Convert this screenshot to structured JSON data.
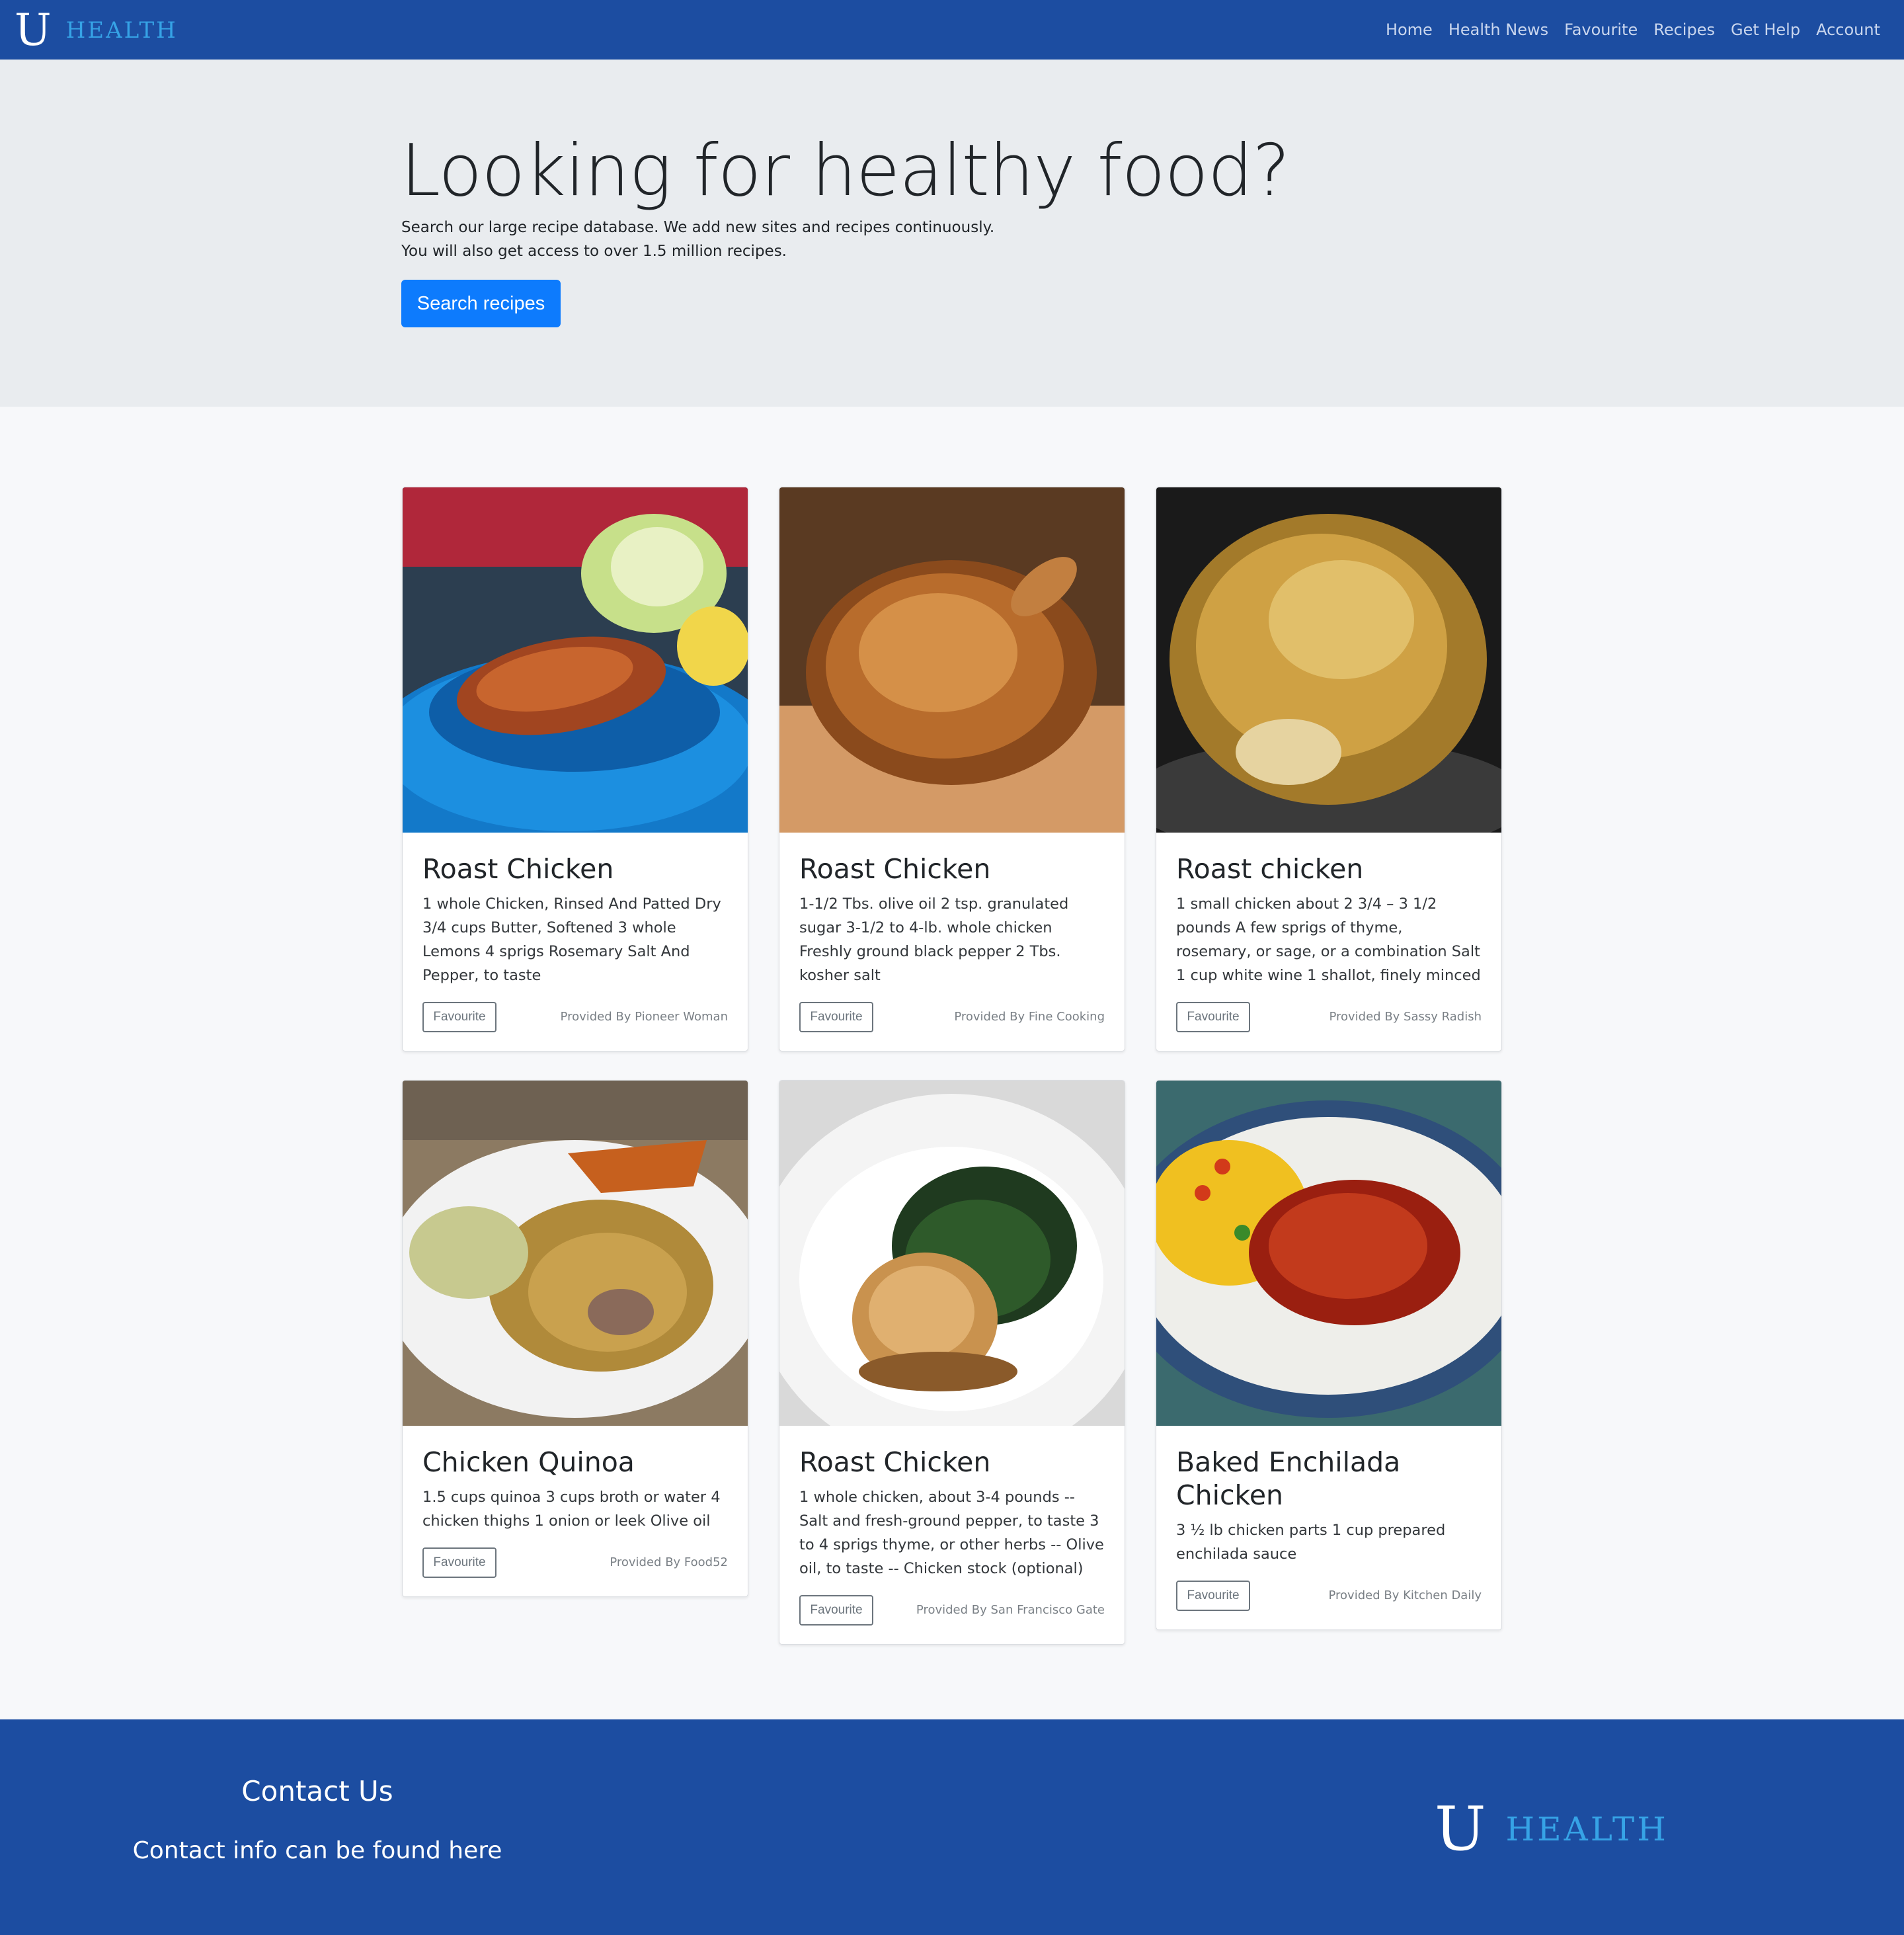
{
  "brand": {
    "letter": "U",
    "word": "HEALTH"
  },
  "nav": [
    {
      "label": "Home"
    },
    {
      "label": "Health News"
    },
    {
      "label": "Favourite"
    },
    {
      "label": "Recipes"
    },
    {
      "label": "Get Help"
    },
    {
      "label": "Account"
    }
  ],
  "hero": {
    "title": "Looking for healthy food?",
    "line1": "Search our large recipe database. We add new sites and recipes continuously.",
    "line2": "You will also get access to over 1.5 million recipes.",
    "button": "Search recipes"
  },
  "cards": [
    {
      "title": "Roast Chicken",
      "text": "1 whole Chicken, Rinsed And Patted Dry 3/4 cups Butter, Softened 3 whole Lemons 4 sprigs Rosemary Salt And Pepper, to taste",
      "fav": "Favourite",
      "provider": "Provided By Pioneer Woman"
    },
    {
      "title": "Roast Chicken",
      "text": "1-1/2 Tbs. olive oil 2 tsp. granulated sugar 3-1/2 to 4-lb. whole chicken Freshly ground black pepper 2 Tbs. kosher salt",
      "fav": "Favourite",
      "provider": "Provided By Fine Cooking"
    },
    {
      "title": "Roast chicken",
      "text": "1 small chicken about 2 3/4 – 3 1/2 pounds A few sprigs of thyme, rosemary, or sage, or a combination Salt 1 cup white wine 1 shallot, finely minced",
      "fav": "Favourite",
      "provider": "Provided By Sassy Radish"
    },
    {
      "title": "Chicken Quinoa",
      "text": "1.5 cups quinoa 3 cups broth or water 4 chicken thighs 1 onion or leek Olive oil",
      "fav": "Favourite",
      "provider": "Provided By Food52"
    },
    {
      "title": "Roast Chicken",
      "text": "1 whole chicken, about 3-4 pounds -- Salt and fresh-ground pepper, to taste 3 to 4 sprigs thyme, or other herbs -- Olive oil, to taste -- Chicken stock (optional)",
      "fav": "Favourite",
      "provider": "Provided By San Francisco Gate"
    },
    {
      "title": "Baked Enchilada Chicken",
      "text": "3 ½ lb chicken parts 1 cup prepared enchilada sauce",
      "fav": "Favourite",
      "provider": "Provided By Kitchen Daily"
    }
  ],
  "footer": {
    "heading": "Contact Us",
    "text": "Contact info can be found here"
  },
  "colors": {
    "navbar": "#1c4da1",
    "brand_accent": "#36a3e6",
    "primary_button": "#0d7bfd",
    "hero_bg": "#e9ecef"
  }
}
